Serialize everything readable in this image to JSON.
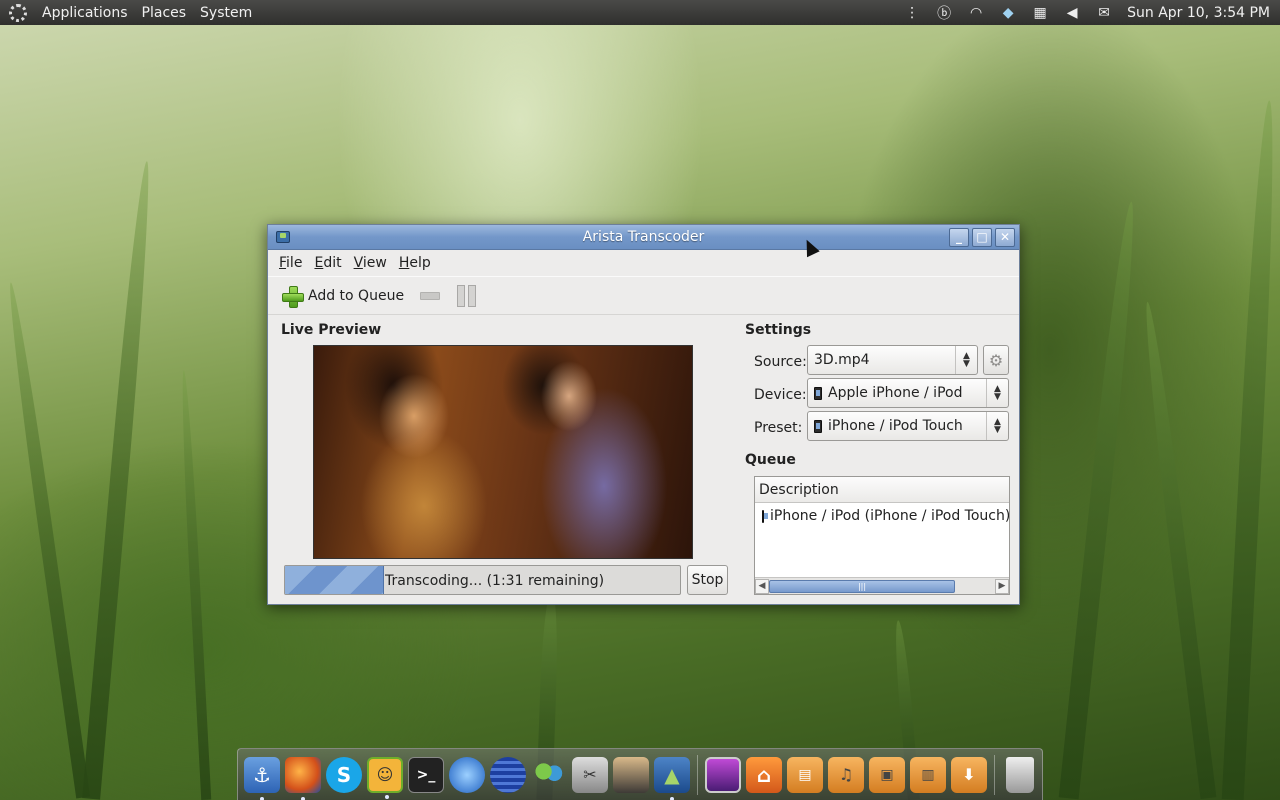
{
  "top_panel": {
    "menus": [
      "Applications",
      "Places",
      "System"
    ],
    "clock": "Sun Apr 10,  3:54 PM",
    "tray_icons": [
      "network-icon",
      "beats-icon",
      "wifi-icon",
      "dropbox-icon",
      "keyboard-icon",
      "volume-icon",
      "mail-icon"
    ]
  },
  "window": {
    "title": "Arista Transcoder",
    "menu": {
      "file": {
        "mnemonic": "F",
        "rest": "ile"
      },
      "edit": {
        "mnemonic": "E",
        "rest": "dit"
      },
      "view": {
        "mnemonic": "V",
        "rest": "iew"
      },
      "help": {
        "mnemonic": "H",
        "rest": "elp"
      }
    },
    "toolbar": {
      "add_label": "Add to Queue"
    },
    "preview": {
      "title": "Live Preview"
    },
    "progress": {
      "text": "Transcoding... (1:31 remaining)",
      "fraction": 0.25
    },
    "stop_label": "Stop",
    "settings": {
      "title": "Settings",
      "source_label": "Source:",
      "source_value": "3D.mp4",
      "device_label": "Device:",
      "device_value": "Apple iPhone / iPod",
      "preset_label": "Preset:",
      "preset_value": "iPhone / iPod Touch"
    },
    "queue": {
      "title": "Queue",
      "column": "Description",
      "rows": [
        "iPhone / iPod (iPhone / iPod Touch):"
      ],
      "scroll_thumb": "|||"
    }
  },
  "dock": {
    "icons": [
      "anchor-icon",
      "firefox-icon",
      "skype-icon",
      "pidgin-icon",
      "terminal-icon",
      "google-earth-icon",
      "web-icon",
      "empathy-icon",
      "video-editor-icon",
      "media-player-icon",
      "arista-icon",
      "monitor-icon",
      "home-folder-icon",
      "documents-folder-icon",
      "music-folder-icon",
      "pictures-folder-icon",
      "videos-folder-icon",
      "downloads-folder-icon",
      "trash-icon"
    ],
    "accent": "#6e94cd"
  }
}
